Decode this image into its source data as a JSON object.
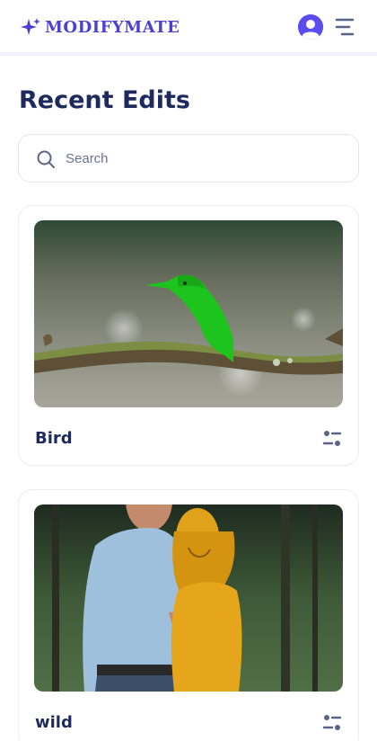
{
  "app": {
    "brand_name": "MODIFYMATE",
    "brand_color": "#4b3fd6",
    "icons": {
      "logo": "sparkle-icon",
      "account": "user-avatar-icon",
      "menu": "hamburger-menu-icon"
    }
  },
  "main": {
    "title": "Recent Edits",
    "search": {
      "placeholder": "Search",
      "value": "",
      "icon": "search-icon"
    },
    "edits": [
      {
        "title": "Bird",
        "image": "kingfisher on mossy branch with green highlight",
        "action_icon": "adjust-settings-icon"
      },
      {
        "title": "wild",
        "image": "couple in forest with yellow highlight",
        "action_icon": "adjust-settings-icon"
      }
    ]
  },
  "colors": {
    "text_dark": "#1e2a5e",
    "accent": "#5a4cf0",
    "card_border": "#eceef6"
  }
}
